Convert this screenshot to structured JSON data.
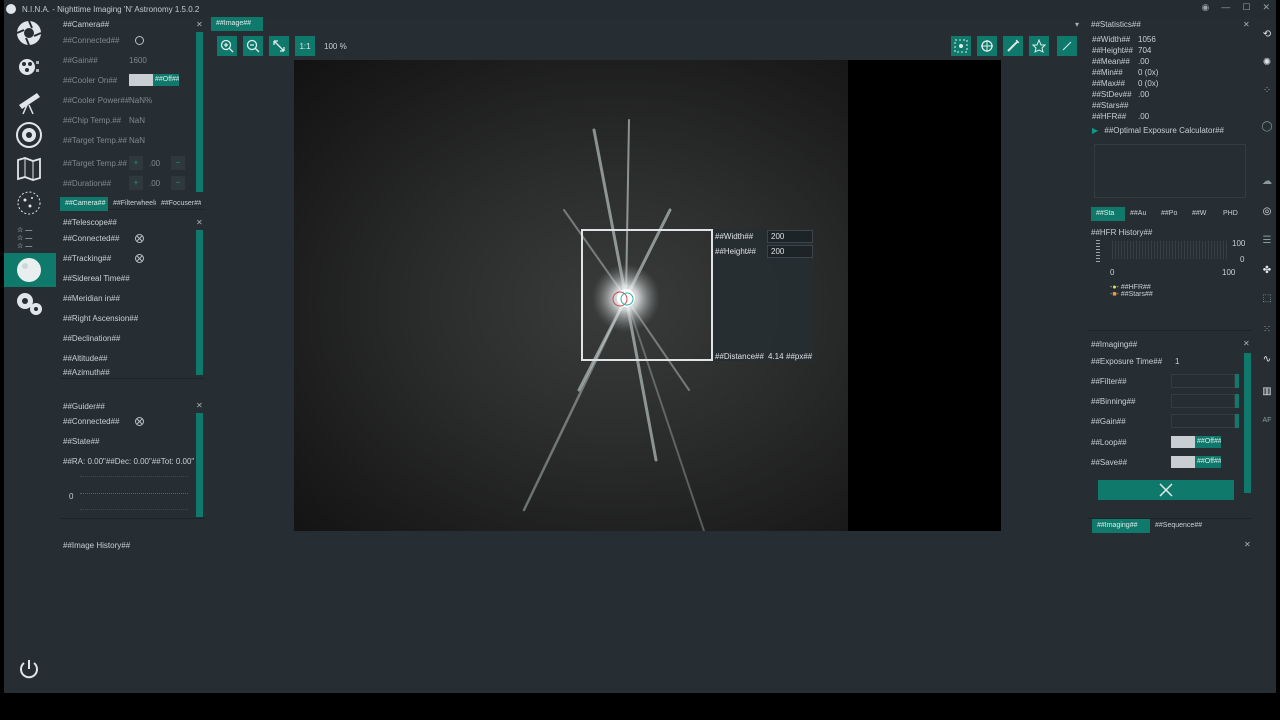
{
  "window": {
    "title": "N.I.N.A. - Nighttime Imaging 'N' Astronomy 1.5.0.2",
    "buttons": [
      "◉",
      "—",
      "☐",
      "✕"
    ]
  },
  "colors": {
    "accent": "#0f7a6c",
    "background": "#262e33",
    "text": "#c8d0d4"
  },
  "sidebar": {
    "items": [
      "camera-icon",
      "filter-wheel-icon",
      "telescope-icon",
      "focuser-icon",
      "sky-map-icon",
      "framing-icon",
      "sequence-icon",
      "imaging-icon",
      "settings-icon"
    ],
    "active": "imaging-icon"
  },
  "camera": {
    "title": "##Camera##",
    "rows": [
      {
        "label": "##Connected##",
        "value": ""
      },
      {
        "label": "##Gain##",
        "value": "1600"
      },
      {
        "label": "##Cooler On##",
        "value": "##Off##"
      },
      {
        "label": "##Cooler Power##",
        "value": "NaN%"
      },
      {
        "label": "##Chip Temp.##",
        "value": "NaN"
      },
      {
        "label": "##Target Temp.##",
        "value": "NaN"
      },
      {
        "label": "##Target Temp.##",
        "value": ".00"
      },
      {
        "label": "##Duration##",
        "value": ".00"
      }
    ],
    "tabs": [
      "##Camera##",
      "##Filterwheel##",
      "##Focuser##"
    ]
  },
  "telescope": {
    "title": "##Telescope##",
    "rows": [
      "##Connected##",
      "##Tracking##",
      "##Sidereal Time##",
      "##Meridian in##",
      "##Right Ascension##",
      "##Declination##",
      "##Altitude##",
      "##Azimuth##"
    ]
  },
  "guider": {
    "title": "##Guider##",
    "rows": [
      "##Connected##",
      "##State##"
    ],
    "rms": "##RA: 0.00\"##Dec: 0.00\"##Tot: 0.00\"",
    "zero": "0"
  },
  "image": {
    "tab": "##Image##",
    "zoom": "100 %",
    "one_to_one": "1:1",
    "roi": {
      "width_label": "##Width##",
      "width_value": "200",
      "height_label": "##Height##",
      "height_value": "200",
      "distance_label": "##Distance##",
      "distance_value": "4.14",
      "distance_unit": "##px##"
    }
  },
  "statistics": {
    "title": "##Statistics##",
    "rows": [
      {
        "label": "##Width##",
        "value": "1056"
      },
      {
        "label": "##Height##",
        "value": "704"
      },
      {
        "label": "##Mean##",
        "value": ".00"
      },
      {
        "label": "##Min##",
        "value": "0 (0x)"
      },
      {
        "label": "##Max##",
        "value": "0 (0x)"
      },
      {
        "label": "##StDev##",
        "value": ".00"
      },
      {
        "label": "##Stars##",
        "value": ""
      },
      {
        "label": "##HFR##",
        "value": ".00"
      }
    ],
    "calculator": "##Optimal Exposure Calculator##",
    "tabs": [
      "##Sta",
      "##Au",
      "##Po",
      "##W",
      "PHD"
    ]
  },
  "hfr_history": {
    "title": "##HFR History##",
    "y_top": "100",
    "y_bottom": "0",
    "x_left": "0",
    "x_right": "100",
    "legend": [
      "##HFR##",
      "##Stars##"
    ]
  },
  "imaging": {
    "title": "##Imaging##",
    "rows": [
      {
        "label": "##Exposure Time##",
        "value": "1"
      },
      {
        "label": "##Filter##",
        "value": ""
      },
      {
        "label": "##Binning##",
        "value": ""
      },
      {
        "label": "##Gain##",
        "value": ""
      },
      {
        "label": "##Loop##",
        "value": "##Off##"
      },
      {
        "label": "##Save##",
        "value": "##Off##"
      }
    ],
    "tabs": [
      "##Imaging##",
      "##Sequence##"
    ]
  },
  "image_history": {
    "title": "##Image History##"
  }
}
